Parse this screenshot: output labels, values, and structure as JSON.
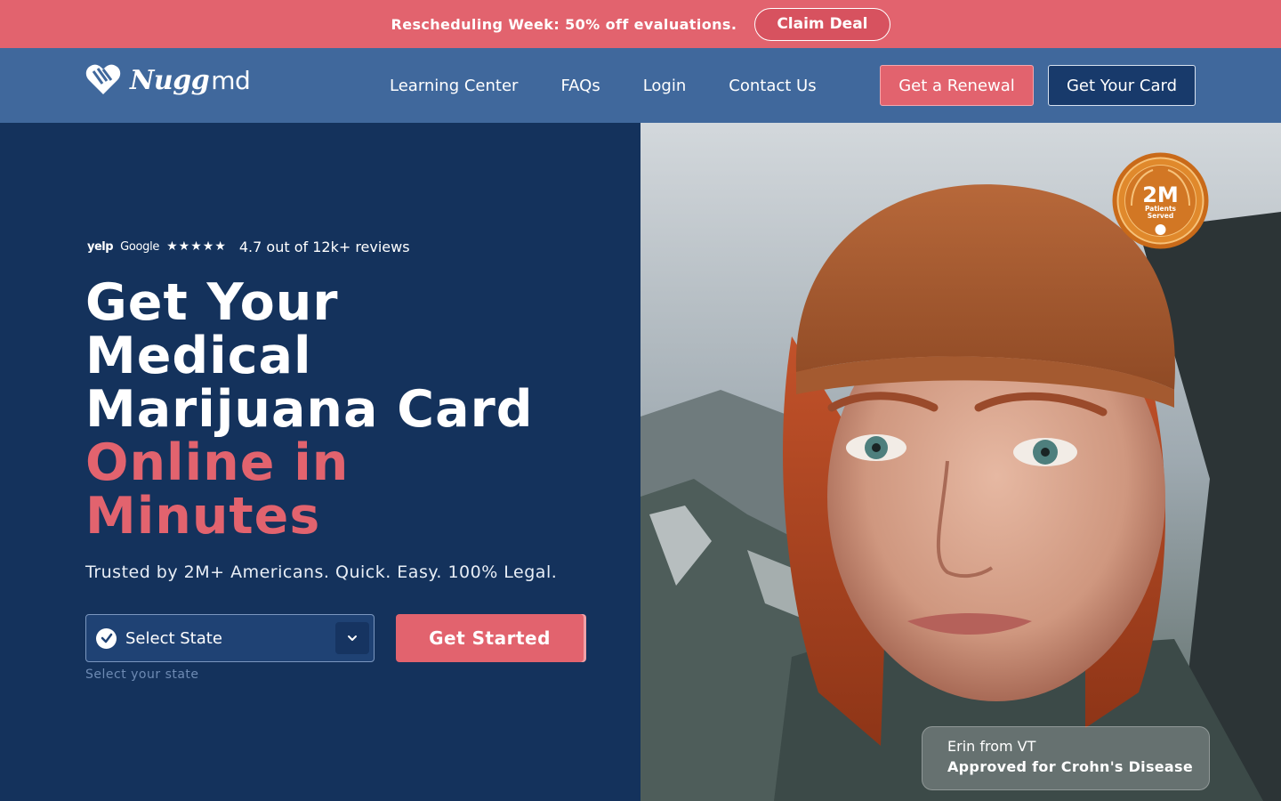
{
  "promo": {
    "text": "Rescheduling Week: 50% off evaluations.",
    "button": "Claim Deal",
    "color": "#e2636e"
  },
  "header": {
    "logo": {
      "word": "Nugg",
      "suffix": "md",
      "icon": "heart-logo-icon"
    },
    "nav": [
      "Learning Center",
      "FAQs",
      "Login",
      "Contact Us"
    ],
    "renewal_button": "Get a Renewal",
    "card_button": "Get Your Card",
    "background": "#40689c"
  },
  "hero": {
    "reviews": {
      "yelp": "yelp",
      "google": "Google",
      "stars": "★★★★★",
      "rating_text": "4.7 out of 12k+ reviews"
    },
    "headline": {
      "line1": "Get Your",
      "line2": "Medical",
      "line3": "Marijuana Card",
      "accent1": "Online in",
      "accent2": "Minutes"
    },
    "subtitle": "Trusted by 2M+ Americans. Quick. Easy. 100% Legal.",
    "state_select": {
      "value": "Select State",
      "hint": "Select your state",
      "icon": "check-circle-icon",
      "chevron": "chevron-down-icon"
    },
    "cta": "Get Started",
    "background": "#14325c",
    "accent_color": "#e2636e"
  },
  "badge": {
    "number": "2M",
    "line1": "Patients",
    "line2": "Served"
  },
  "testimonial": {
    "name": "Erin from VT",
    "condition": "Approved for Crohn's Disease"
  }
}
